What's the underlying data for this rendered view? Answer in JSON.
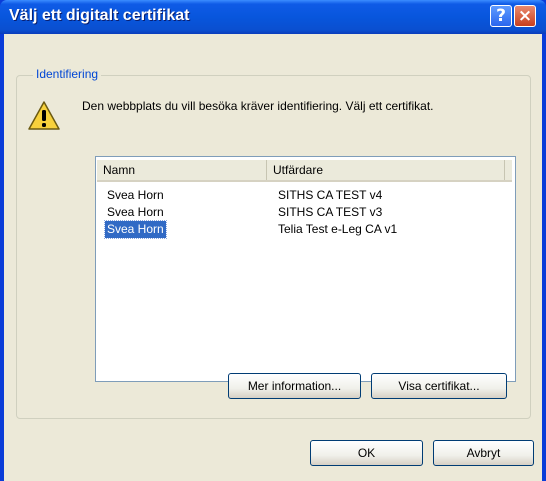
{
  "window": {
    "title": "Välj ett digitalt certifikat",
    "help_glyph": "?",
    "close_glyph": "×"
  },
  "group": {
    "label": "Identifiering",
    "icon": "warning-icon",
    "message": "Den webbplats du vill besöka kräver identifiering. Välj ett certifikat."
  },
  "certificates": {
    "columns": [
      "Namn",
      "Utfärdare"
    ],
    "rows": [
      {
        "name": "Svea Horn",
        "issuer": "SITHS CA TEST v4",
        "selected": false
      },
      {
        "name": "Svea Horn",
        "issuer": "SITHS CA TEST v3",
        "selected": false
      },
      {
        "name": "Svea Horn",
        "issuer": "Telia Test e-Leg CA v1",
        "selected": true
      }
    ]
  },
  "buttons": {
    "more_info": "Mer information...",
    "view_cert": "Visa certifikat...",
    "ok": "OK",
    "cancel": "Avbryt"
  },
  "colors": {
    "titlebar": "#0856dd",
    "client_bg": "#ece9d8",
    "selection": "#316ac5",
    "group_label": "#0046d5"
  }
}
